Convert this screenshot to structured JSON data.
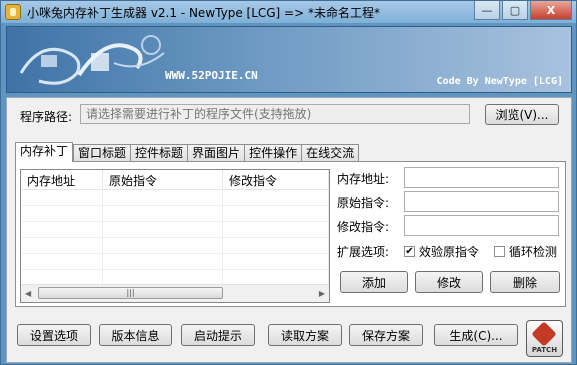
{
  "window": {
    "title": "小咪兔内存补丁生成器 v2.1  -  NewType [LCG]   =>   *未命名工程*",
    "min_label": "—",
    "max_label": "▢",
    "close_label": "X"
  },
  "banner": {
    "url_text": "WWW.52POJIE.CN",
    "code_text": "Code By NewType [LCG]"
  },
  "path": {
    "label": "程序路径:",
    "placeholder": "请选择需要进行补丁的程序文件(支持拖放)",
    "browse_label": "浏览(V)..."
  },
  "tabs": [
    "内存补丁",
    "窗口标题",
    "控件标题",
    "界面图片",
    "控件操作",
    "在线交流"
  ],
  "table": {
    "headers": [
      "内存地址",
      "原始指令",
      "修改指令"
    ]
  },
  "form": {
    "address_label": "内存地址:",
    "original_label": "原始指令:",
    "modified_label": "修改指令:",
    "ext_label": "扩展选项:",
    "verify_label": "效验原指令",
    "verify_checked": true,
    "loop_label": "循环检测",
    "loop_checked": false,
    "add_label": "添加",
    "edit_label": "修改",
    "delete_label": "删除"
  },
  "bottom": {
    "settings_label": "设置选项",
    "version_label": "版本信息",
    "startup_label": "启动提示",
    "load_label": "读取方案",
    "save_label": "保存方案",
    "generate_label": "生成(C)...",
    "patch_label": "PATCH"
  },
  "colors": {
    "window_frame": "#5f95bf",
    "banner_start": "#3f73a7",
    "banner_end": "#a8c2de"
  }
}
